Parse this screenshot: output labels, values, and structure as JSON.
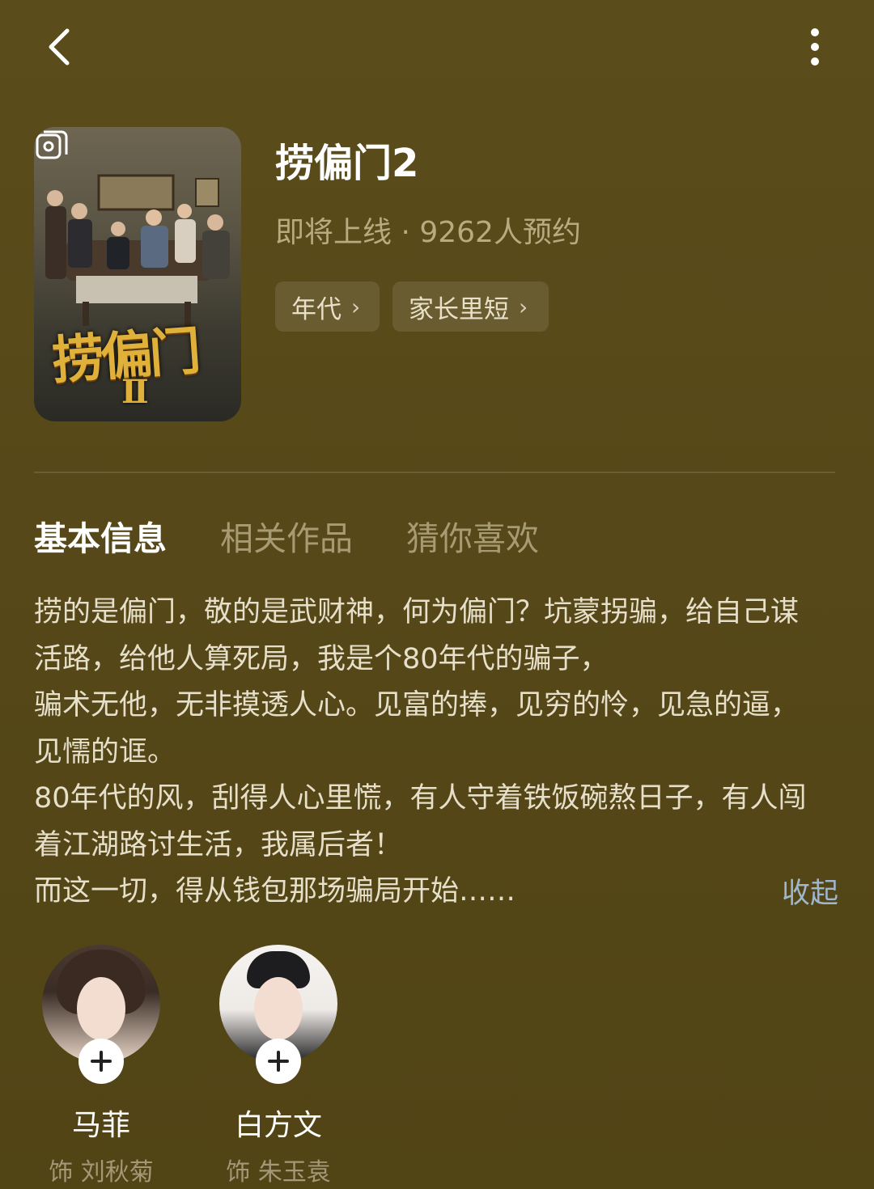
{
  "topbar": {
    "back_icon": "chevron-left-icon",
    "more_icon": "more-vertical-icon"
  },
  "poster": {
    "logo_text": "捞偏门",
    "logo_sub": "Ⅱ",
    "gallery_icon": "gallery-icon"
  },
  "show": {
    "title": "捞偏门2",
    "status": "即将上线 · 9262人预约",
    "tags": [
      {
        "label": "年代"
      },
      {
        "label": "家长里短"
      }
    ]
  },
  "tabs": [
    {
      "label": "基本信息",
      "active": true
    },
    {
      "label": "相关作品",
      "active": false
    },
    {
      "label": "猜你喜欢",
      "active": false
    }
  ],
  "description": {
    "lines": [
      "捞的是偏门，敬的是武财神，何为偏门？坑蒙拐骗，给自己谋",
      "活路，给他人算死局，我是个80年代的骗子，",
      "骗术无他，无非摸透人心。见富的捧，见穷的怜，见急的逼，",
      "见懦的诓。",
      "80年代的风，刮得人心里慌，有人守着铁饭碗熬日子，有人闯",
      "着江湖路讨生活，我属后者！",
      "而这一切，得从钱包那场骗局开始……"
    ],
    "collapse_label": "收起"
  },
  "cast": [
    {
      "name": "马菲",
      "role": "饰 刘秋菊",
      "follow_icon": "plus-icon"
    },
    {
      "name": "白方文",
      "role": "饰 朱玉袁",
      "follow_icon": "plus-icon"
    }
  ],
  "colors": {
    "background": "#574918",
    "muted_text": "#a69b73",
    "link": "#9fb6cf"
  }
}
